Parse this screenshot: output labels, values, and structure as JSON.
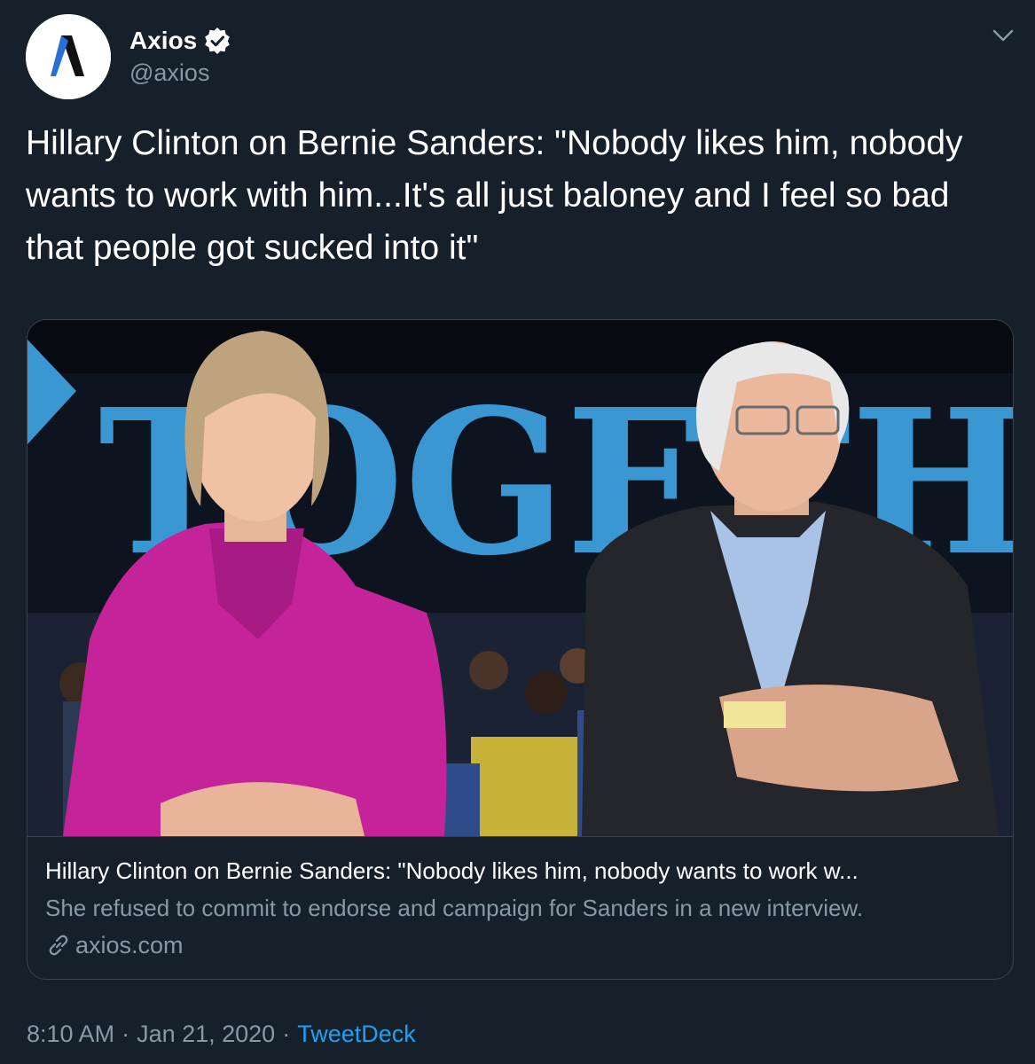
{
  "author": {
    "display_name": "Axios",
    "handle": "@axios",
    "avatar_icon": "axios-logo-icon",
    "verified_icon": "verified-badge-icon"
  },
  "menu_icon": "chevron-down-icon",
  "tweet": {
    "text": "Hillary Clinton on Bernie Sanders: \"Nobody likes him, nobody wants to work with him...It's all just baloney and I feel so bad that people got sucked into it\""
  },
  "card": {
    "image_icon": "photo-hillary-clinton-bernie-sanders",
    "banner_text": "TOGETH",
    "title": "Hillary Clinton on Bernie Sanders: \"Nobody likes him, nobody wants to work w...",
    "description": "She refused to commit to endorse and campaign for Sanders in a new interview.",
    "domain": "axios.com",
    "link_icon": "link-icon"
  },
  "meta": {
    "time": "8:10 AM",
    "separator": "·",
    "date": "Jan 21, 2020",
    "source": "TweetDeck"
  },
  "colors": {
    "background": "#15202b",
    "text": "#ffffff",
    "secondary": "#8899a6",
    "accent": "#1da1f2",
    "border": "#38444d",
    "banner_blue": "#3a97d1",
    "suit_magenta": "#c4239a"
  }
}
